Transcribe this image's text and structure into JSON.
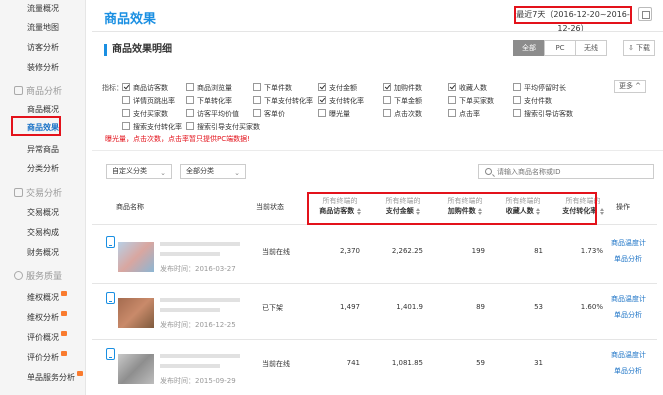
{
  "sidebar": {
    "top_items": [
      "流量概况",
      "流量地图",
      "访客分析",
      "装修分析"
    ],
    "groups": [
      {
        "title": "商品分析",
        "icon": "box-icon",
        "items": [
          "商品概况",
          "商品效果",
          "异常商品",
          "分类分析"
        ]
      },
      {
        "title": "交易分析",
        "icon": "cart-icon",
        "items": [
          "交易概况",
          "交易构成",
          "财务概况"
        ]
      },
      {
        "title": "服务质量",
        "icon": "headset-icon",
        "items": [
          "维权概况",
          "维权分析",
          "评价概况",
          "评价分析",
          "单品服务分析"
        ]
      }
    ],
    "active": "商品效果"
  },
  "header": {
    "title": "商品效果",
    "date_range": "最近7天（2016-12-20~2016-12-26）"
  },
  "section": {
    "title": "商品效果明细",
    "tabs": [
      "全部",
      "PC",
      "无线"
    ],
    "active_tab": "全部",
    "download_label": "下载"
  },
  "indicators": {
    "label": "指标：",
    "more_label": "更多 ^",
    "items": [
      {
        "label": "商品访客数",
        "checked": true
      },
      {
        "label": "商品浏览量",
        "checked": false
      },
      {
        "label": "下单件数",
        "checked": false
      },
      {
        "label": "支付金额",
        "checked": true
      },
      {
        "label": "加购件数",
        "checked": true
      },
      {
        "label": "收藏人数",
        "checked": true
      },
      {
        "label": "平均停留时长",
        "checked": false
      },
      {
        "label": "详情页跳出率",
        "checked": false
      },
      {
        "label": "下单转化率",
        "checked": false
      },
      {
        "label": "下单支付转化率",
        "checked": false
      },
      {
        "label": "支付转化率",
        "checked": true
      },
      {
        "label": "下单金额",
        "checked": false
      },
      {
        "label": "下单买家数",
        "checked": false
      },
      {
        "label": "支付件数",
        "checked": false
      },
      {
        "label": "支付买家数",
        "checked": false
      },
      {
        "label": "访客平均价值",
        "checked": false
      },
      {
        "label": "客单价",
        "checked": false
      },
      {
        "label": "曝光量",
        "checked": false
      },
      {
        "label": "点击次数",
        "checked": false
      },
      {
        "label": "点击率",
        "checked": false
      },
      {
        "label": "搜索引导访客数",
        "checked": false
      },
      {
        "label": "搜索支付转化率",
        "checked": false
      },
      {
        "label": "搜索引导支付买家数",
        "checked": false
      }
    ],
    "warning": "曝光量，点击次数，点击率暂只提供PC端数据!"
  },
  "filters": {
    "category_custom": "自定义分类",
    "category_all": "全部分类",
    "search_placeholder": "请输入商品名称或ID"
  },
  "table": {
    "headers": {
      "name": "商品名称",
      "status": "当前状态",
      "prefix": "所有终端的",
      "metrics": [
        "商品访客数",
        "支付金额",
        "加购件数",
        "收藏人数",
        "支付转化率"
      ],
      "action": "操作"
    },
    "rows": [
      {
        "pub_label": "发布时间：2016-03-27",
        "status": "当前在线",
        "values": [
          "2,370",
          "2,262.25",
          "199",
          "81",
          "1.73%"
        ]
      },
      {
        "pub_label": "发布时间：2016-12-25",
        "status": "已下架",
        "values": [
          "1,497",
          "1,401.9",
          "89",
          "53",
          "1.60%"
        ]
      },
      {
        "pub_label": "发布时间：2015-09-29",
        "status": "当前在线",
        "values": [
          "741",
          "1,081.85",
          "59",
          "31",
          ""
        ]
      }
    ],
    "links": [
      "商品温度计",
      "单品分析"
    ]
  },
  "colors": {
    "accent": "#1a8fe2",
    "highlight": "#e3121b",
    "badge": "#f97b2e"
  }
}
